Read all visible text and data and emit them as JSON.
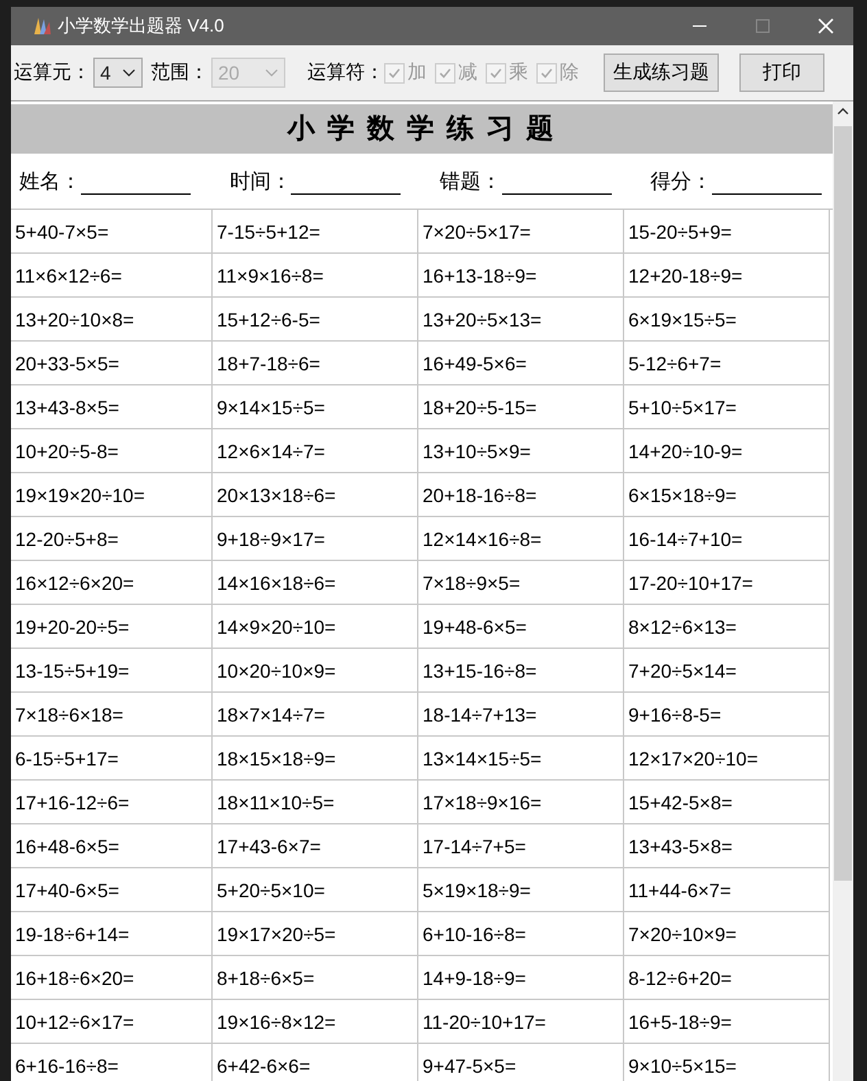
{
  "window": {
    "title": "小学数学出题器 V4.0"
  },
  "toolbar": {
    "operands_label": "运算元：",
    "operands": {
      "value": "4",
      "disabled": false
    },
    "range_label": "范围：",
    "range": {
      "value": "20",
      "disabled": true
    },
    "operators_label": "运算符：",
    "operators": [
      {
        "label": "加",
        "checked": true,
        "disabled": true
      },
      {
        "label": "减",
        "checked": true,
        "disabled": true
      },
      {
        "label": "乘",
        "checked": true,
        "disabled": true
      },
      {
        "label": "除",
        "checked": true,
        "disabled": true
      }
    ],
    "generate_button": "生成练习题",
    "print_button": "打印"
  },
  "sheet": {
    "title": "小 学 数 学 练 习 题",
    "fields": [
      "姓名：",
      "时间：",
      "错题：",
      "得分："
    ],
    "rows": [
      [
        "5+40-7×5=",
        "7-15÷5+12=",
        "7×20÷5×17=",
        "15-20÷5+9="
      ],
      [
        "11×6×12÷6=",
        "11×9×16÷8=",
        "16+13-18÷9=",
        "12+20-18÷9="
      ],
      [
        "13+20÷10×8=",
        "15+12÷6-5=",
        "13+20÷5×13=",
        "6×19×15÷5="
      ],
      [
        "20+33-5×5=",
        "18+7-18÷6=",
        "16+49-5×6=",
        "5-12÷6+7="
      ],
      [
        "13+43-8×5=",
        "9×14×15÷5=",
        "18+20÷5-15=",
        "5+10÷5×17="
      ],
      [
        "10+20÷5-8=",
        "12×6×14÷7=",
        "13+10÷5×9=",
        "14+20÷10-9="
      ],
      [
        "19×19×20÷10=",
        "20×13×18÷6=",
        "20+18-16÷8=",
        "6×15×18÷9="
      ],
      [
        "12-20÷5+8=",
        "9+18÷9×17=",
        "12×14×16÷8=",
        "16-14÷7+10="
      ],
      [
        "16×12÷6×20=",
        "14×16×18÷6=",
        "7×18÷9×5=",
        "17-20÷10+17="
      ],
      [
        "19+20-20÷5=",
        "14×9×20÷10=",
        "19+48-6×5=",
        "8×12÷6×13="
      ],
      [
        "13-15÷5+19=",
        "10×20÷10×9=",
        "13+15-16÷8=",
        "7+20÷5×14="
      ],
      [
        "7×18÷6×18=",
        "18×7×14÷7=",
        "18-14÷7+13=",
        "9+16÷8-5="
      ],
      [
        "6-15÷5+17=",
        "18×15×18÷9=",
        "13×14×15÷5=",
        "12×17×20÷10="
      ],
      [
        "17+16-12÷6=",
        "18×11×10÷5=",
        "17×18÷9×16=",
        "15+42-5×8="
      ],
      [
        "16+48-6×5=",
        "17+43-6×7=",
        "17-14÷7+5=",
        "13+43-5×8="
      ],
      [
        "17+40-6×5=",
        "5+20÷5×10=",
        "5×19×18÷9=",
        "11+44-6×7="
      ],
      [
        "19-18÷6+14=",
        "19×17×20÷5=",
        "6+10-16÷8=",
        "7×20÷10×9="
      ],
      [
        "16+18÷6×20=",
        "8+18÷6×5=",
        "14+9-18÷9=",
        "8-12÷6+20="
      ],
      [
        "10+12÷6×17=",
        "19×16÷8×12=",
        "11-20÷10+17=",
        "16+5-18÷9="
      ],
      [
        "6+16-16÷8=",
        "6+42-6×6=",
        "9+47-5×5=",
        "9×10÷5×15="
      ]
    ]
  }
}
